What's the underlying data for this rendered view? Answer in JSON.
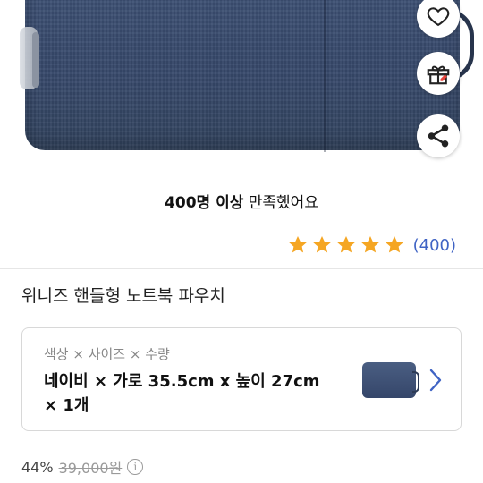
{
  "product_image": {
    "icon": "laptop-pouch-image"
  },
  "actions": {
    "like_icon": "heart-icon",
    "gift_icon": "gift-icon",
    "share_icon": "share-icon"
  },
  "satisfaction": {
    "bold": "400명 이상",
    "rest": " 만족했어요"
  },
  "rating": {
    "stars": 5,
    "count": "(400)",
    "star_color": "#f5a623",
    "count_color": "#3f63c4"
  },
  "product": {
    "name": "위니즈 핸들형 노트북 파우치"
  },
  "option": {
    "label": "색상 × 사이즈 × 수량",
    "value": "네이비 × 가로 35.5cm x 높이 27cm × 1개"
  },
  "price": {
    "discount": "44%",
    "original": "39,000원",
    "info_icon": "info-icon"
  }
}
